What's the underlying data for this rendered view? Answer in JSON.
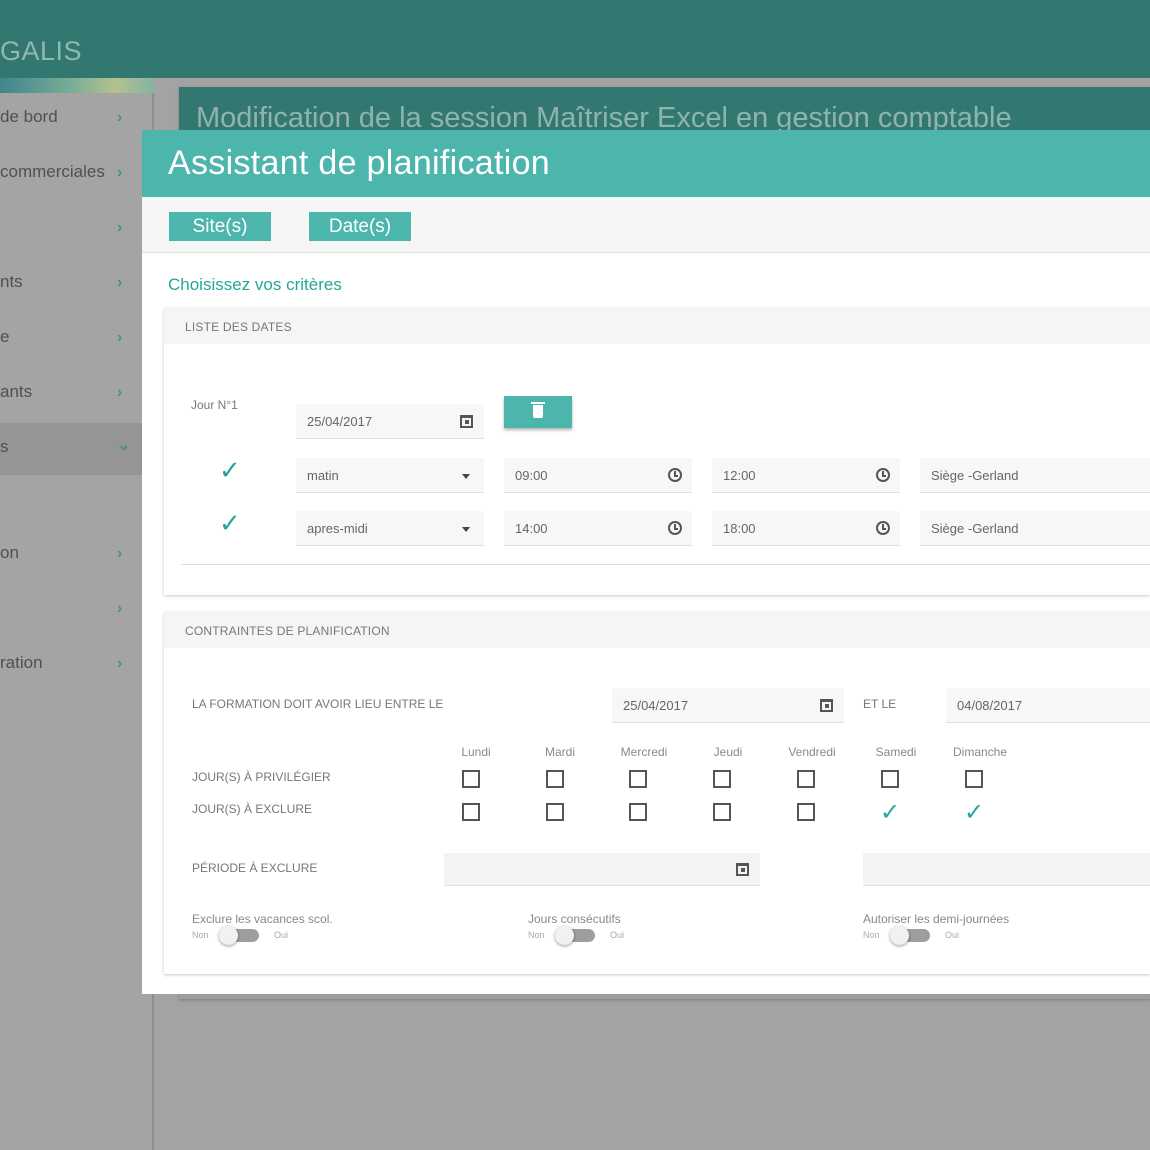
{
  "app": {
    "logo": "GALIS"
  },
  "sidebar": {
    "items": [
      {
        "label": "de bord",
        "chevron": "›"
      },
      {
        "label": "commerciales",
        "chevron": "›"
      },
      {
        "label": "",
        "chevron": "›"
      },
      {
        "label": "nts",
        "chevron": "›"
      },
      {
        "label": "e",
        "chevron": "›"
      },
      {
        "label": "ants",
        "chevron": "›"
      },
      {
        "label": "s",
        "chevron": "⌄"
      },
      {
        "label": "on",
        "chevron": "›"
      },
      {
        "label": "",
        "chevron": "›"
      },
      {
        "label": "ration",
        "chevron": "›"
      }
    ]
  },
  "background_page": {
    "title": "Modification de la session Maîtriser Excel en gestion comptable"
  },
  "modal": {
    "title": "Assistant de planification",
    "tabs": [
      "Site(s)",
      "Date(s)"
    ],
    "heading": "Choisissez vos critères",
    "dates_card": {
      "title": "LISTE DES DATES",
      "day_label": "Jour N°1",
      "day_date": "25/04/2017",
      "rows": [
        {
          "period": "matin",
          "start": "09:00",
          "end": "12:00",
          "site": "Siège -Gerland"
        },
        {
          "period": "apres-midi",
          "start": "14:00",
          "end": "18:00",
          "site": "Siège -Gerland"
        }
      ]
    },
    "constraints_card": {
      "title": "CONTRAINTES DE PLANIFICATION",
      "between_label": "LA FORMATION DOIT AVOIR LIEU ENTRE LE",
      "start_date": "25/04/2017",
      "and_label": "ET LE",
      "end_date": "04/08/2017",
      "days": [
        "Lundi",
        "Mardi",
        "Mercredi",
        "Jeudi",
        "Vendredi",
        "Samedi",
        "Dimanche"
      ],
      "prefer_label": "JOUR(S) À PRIVILÉGIER",
      "exclude_label": "JOUR(S) À EXCLURE",
      "prefer_checked": [
        false,
        false,
        false,
        false,
        false,
        false,
        false
      ],
      "exclude_checked": [
        false,
        false,
        false,
        false,
        false,
        true,
        true
      ],
      "period_exclude_label": "PÉRIODE À EXCLURE",
      "toggles": [
        {
          "label": "Exclure les vacances scol.",
          "off": "Non",
          "on": "Oui",
          "value": false
        },
        {
          "label": "Jours consécutifs",
          "off": "Non",
          "on": "Oui",
          "value": false
        },
        {
          "label": "Autoriser les demi-journées",
          "off": "Non",
          "on": "Oui",
          "value": false
        }
      ]
    }
  },
  "colors": {
    "accent": "#4db6ac",
    "accent_dark": "#26a69a",
    "topbar": "#337870"
  }
}
